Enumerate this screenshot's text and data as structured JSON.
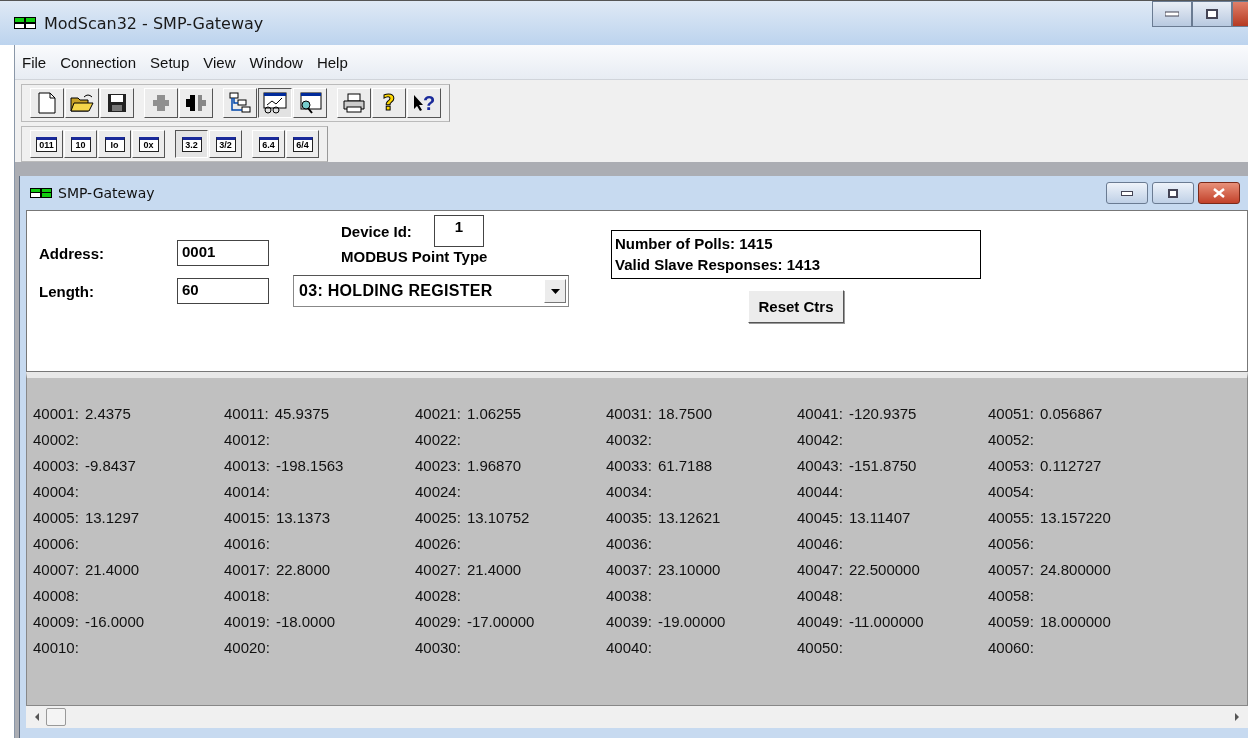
{
  "window": {
    "title": "ModScan32 - SMP-Gateway"
  },
  "menu": [
    "File",
    "Connection",
    "Setup",
    "View",
    "Window",
    "Help"
  ],
  "toolbar_groups": [
    [
      {
        "kind": "new",
        "pressed": false,
        "disabled": false
      },
      {
        "kind": "open",
        "pressed": false,
        "disabled": false
      },
      {
        "kind": "save",
        "pressed": false,
        "disabled": false
      }
    ],
    [
      {
        "kind": "connect",
        "pressed": false,
        "disabled": true
      },
      {
        "kind": "disconnect",
        "pressed": false,
        "disabled": false
      }
    ],
    [
      {
        "kind": "tree",
        "pressed": false,
        "disabled": false
      },
      {
        "kind": "chart",
        "pressed": true,
        "disabled": false
      },
      {
        "kind": "monitor",
        "pressed": false,
        "disabled": false
      }
    ],
    [
      {
        "kind": "print",
        "pressed": false,
        "disabled": false
      },
      {
        "kind": "help",
        "glyph": "?",
        "pressed": false,
        "disabled": false
      },
      {
        "kind": "context-help",
        "glyph": "?",
        "pressed": false,
        "disabled": false
      }
    ]
  ],
  "format_groups": [
    [
      {
        "label": "011",
        "pressed": false
      },
      {
        "label": "10",
        "pressed": false
      },
      {
        "label": "Io",
        "pressed": false
      },
      {
        "label": "0x",
        "pressed": false
      }
    ],
    [
      {
        "label": "3.2",
        "pressed": true
      },
      {
        "label": "3/2",
        "pressed": false
      }
    ],
    [
      {
        "label": "6.4",
        "pressed": false
      },
      {
        "label": "6/4",
        "pressed": false
      }
    ]
  ],
  "child": {
    "title": "SMP-Gateway",
    "address_label": "Address:",
    "address": "0001",
    "length_label": "Length:",
    "length": "60",
    "device_id_label": "Device Id:",
    "device_id": "1",
    "point_type_label": "MODBUS Point Type",
    "point_type": "03: HOLDING REGISTER",
    "stats": [
      "Number of Polls: 1415",
      "Valid Slave Responses: 1413"
    ],
    "reset_button": "Reset Ctrs"
  },
  "register_columns": [
    [
      {
        "address": "40001:",
        "value": "2.4375"
      },
      {
        "address": "40002:"
      },
      {
        "address": "40003:",
        "value": "-9.8437"
      },
      {
        "address": "40004:"
      },
      {
        "address": "40005:",
        "value": "13.1297"
      },
      {
        "address": "40006:"
      },
      {
        "address": "40007:",
        "value": "21.4000"
      },
      {
        "address": "40008:"
      },
      {
        "address": "40009:",
        "value": "-16.0000"
      },
      {
        "address": "40010:"
      }
    ],
    [
      {
        "address": "40011:",
        "value": "45.9375"
      },
      {
        "address": "40012:"
      },
      {
        "address": "40013:",
        "value": "-198.1563"
      },
      {
        "address": "40014:"
      },
      {
        "address": "40015:",
        "value": "13.1373"
      },
      {
        "address": "40016:"
      },
      {
        "address": "40017:",
        "value": "22.8000"
      },
      {
        "address": "40018:"
      },
      {
        "address": "40019:",
        "value": "-18.0000"
      },
      {
        "address": "40020:"
      }
    ],
    [
      {
        "address": "40021:",
        "value": "1.06255"
      },
      {
        "address": "40022:"
      },
      {
        "address": "40023:",
        "value": "1.96870"
      },
      {
        "address": "40024:"
      },
      {
        "address": "40025:",
        "value": "13.10752"
      },
      {
        "address": "40026:"
      },
      {
        "address": "40027:",
        "value": "21.4000"
      },
      {
        "address": "40028:"
      },
      {
        "address": "40029:",
        "value": "-17.00000"
      },
      {
        "address": "40030:"
      }
    ],
    [
      {
        "address": "40031:",
        "value": "18.7500"
      },
      {
        "address": "40032:"
      },
      {
        "address": "40033:",
        "value": "61.7188"
      },
      {
        "address": "40034:"
      },
      {
        "address": "40035:",
        "value": "13.12621"
      },
      {
        "address": "40036:"
      },
      {
        "address": "40037:",
        "value": "23.10000"
      },
      {
        "address": "40038:"
      },
      {
        "address": "40039:",
        "value": "-19.00000"
      },
      {
        "address": "40040:"
      }
    ],
    [
      {
        "address": "40041:",
        "value": "-120.9375"
      },
      {
        "address": "40042:"
      },
      {
        "address": "40043:",
        "value": "-151.8750"
      },
      {
        "address": "40044:"
      },
      {
        "address": "40045:",
        "value": "13.11407"
      },
      {
        "address": "40046:"
      },
      {
        "address": "40047:",
        "value": "22.500000"
      },
      {
        "address": "40048:"
      },
      {
        "address": "40049:",
        "value": "-11.000000"
      },
      {
        "address": "40050:"
      }
    ],
    [
      {
        "address": "40051:",
        "value": "0.056867"
      },
      {
        "address": "40052:"
      },
      {
        "address": "40053:",
        "value": "0.112727"
      },
      {
        "address": "40054:"
      },
      {
        "address": "40055:",
        "value": "13.157220"
      },
      {
        "address": "40056:"
      },
      {
        "address": "40057:",
        "value": "24.800000"
      },
      {
        "address": "40058:"
      },
      {
        "address": "40059:",
        "value": "18.000000"
      },
      {
        "address": "40060:"
      }
    ]
  ]
}
